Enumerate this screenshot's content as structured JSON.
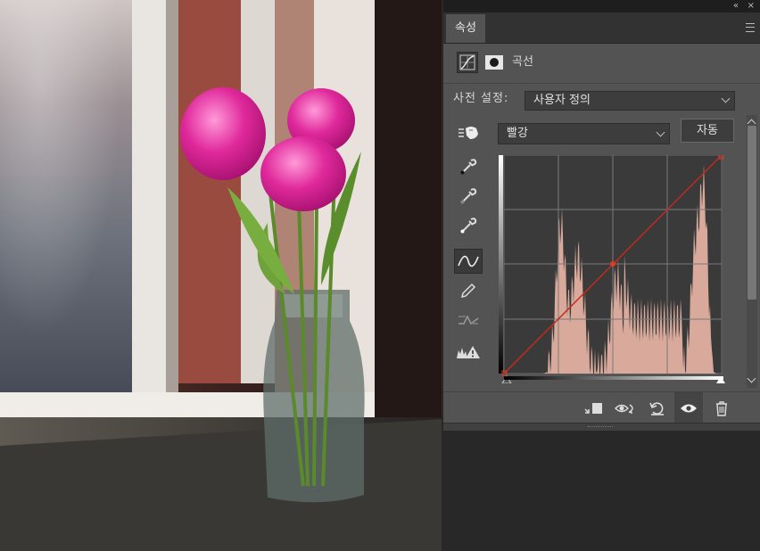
{
  "panel": {
    "tab_label": "속성",
    "adjustment_title": "곡선",
    "preset_label": "사전 설정:",
    "preset_value": "사용자 정의",
    "channel_value": "빨강",
    "auto_label": "자동",
    "icons": {
      "collapse": "double-chevron-right-icon",
      "close": "close-icon",
      "panel_menu": "hamburger-menu-icon",
      "adjustment": "curves-adjustment-icon",
      "mask": "layer-mask-icon",
      "on_image": "on-image-adjustment-hand-icon",
      "tools": [
        "black-point-eyedropper-icon",
        "gray-point-eyedropper-icon",
        "white-point-eyedropper-icon",
        "curve-points-icon",
        "pencil-draw-icon",
        "smooth-curve-icon",
        "clipping-warning-icon"
      ],
      "footer": [
        "clip-to-layer-icon",
        "view-previous-state-icon",
        "reset-icon",
        "visibility-eye-icon",
        "delete-trash-icon"
      ]
    },
    "curve": {
      "channel_color": "#cc2a1a",
      "histogram_color": "#d9aa9b",
      "points": [
        [
          0,
          0
        ],
        [
          128,
          128
        ],
        [
          255,
          255
        ]
      ]
    }
  }
}
